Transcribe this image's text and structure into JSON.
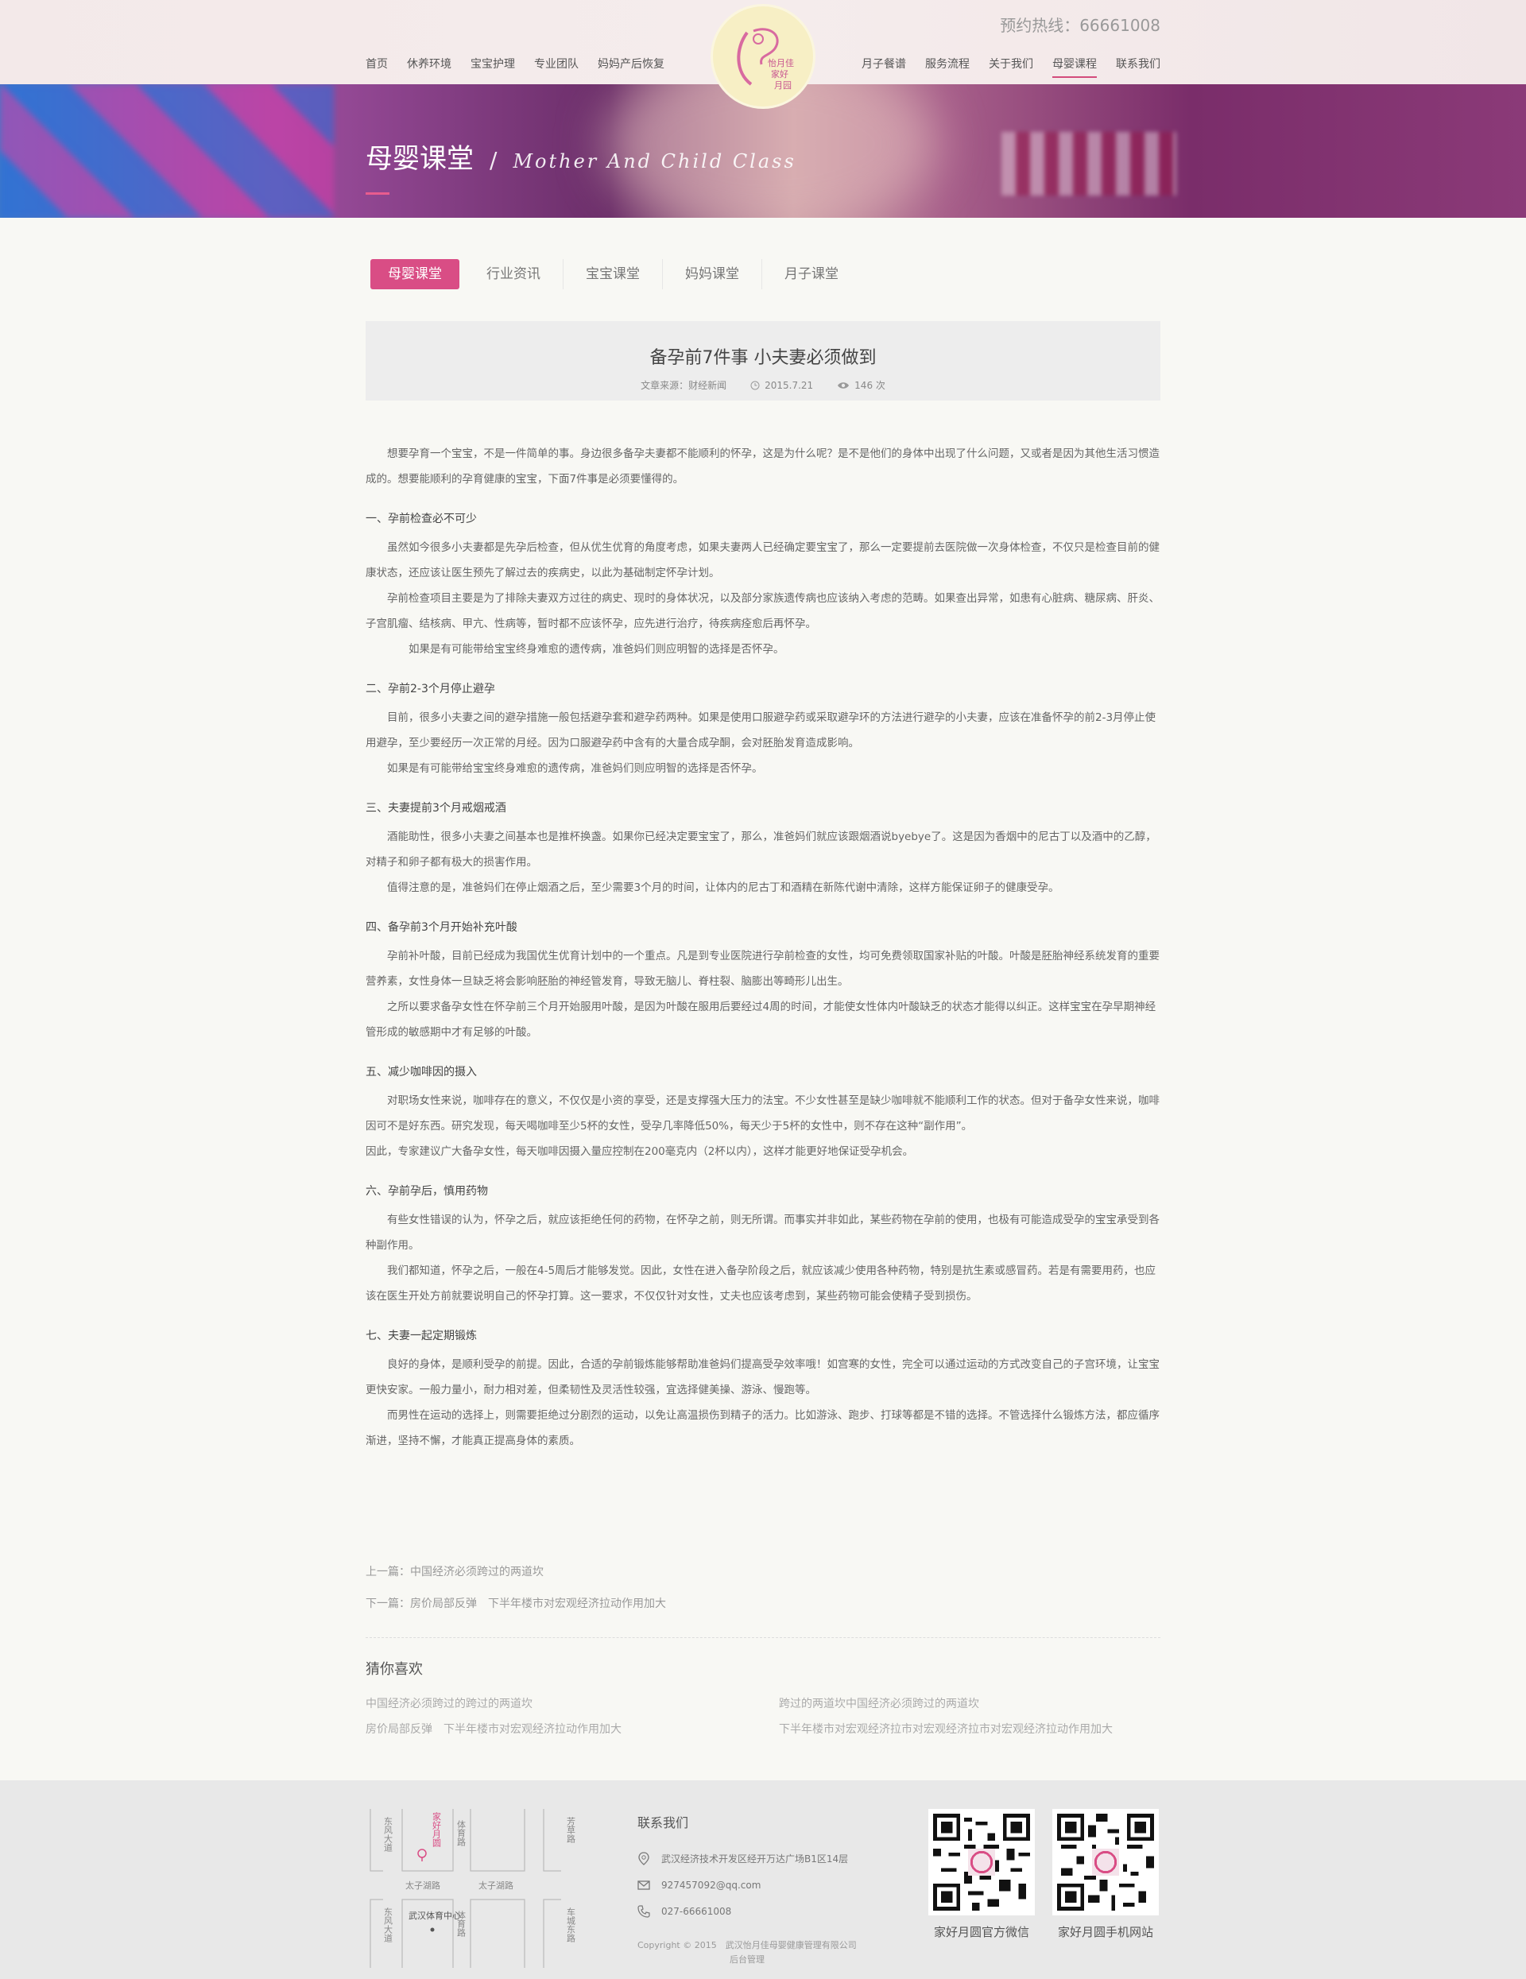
{
  "header": {
    "hotline": "预约热线：66661008",
    "nav_left": [
      "首页",
      "休养环境",
      "宝宝护理",
      "专业团队",
      "妈妈产后恢复"
    ],
    "nav_right": [
      "月子餐谱",
      "服务流程",
      "关于我们",
      "母婴课程",
      "联系我们"
    ],
    "active_nav": "母婴课程",
    "logo_text": "怡月佳家好月园"
  },
  "banner": {
    "title_cn": "母婴课堂",
    "separator": "/",
    "title_en": "Mother And Child Class"
  },
  "tabs": [
    "母婴课堂",
    "行业资讯",
    "宝宝课堂",
    "妈妈课堂",
    "月子课堂"
  ],
  "article": {
    "title": "备孕前7件事 小夫妻必须做到",
    "source": "文章来源：财经新闻",
    "date": "2015.7.21",
    "views": "146 次",
    "intro": "想要孕育一个宝宝，不是一件简单的事。身边很多备孕夫妻都不能顺利的怀孕，这是为什么呢？是不是他们的身体中出现了什么问题，又或者是因为其他生活习惯造成的。想要能顺利的孕育健康的宝宝，下面7件事是必须要懂得的。",
    "sections": [
      {
        "heading": "一、孕前检查必不可少",
        "paras": [
          "虽然如今很多小夫妻都是先孕后检查，但从优生优育的角度考虑，如果夫妻两人已经确定要宝宝了，那么一定要提前去医院做一次身体检查，不仅只是检查目前的健康状态，还应该让医生预先了解过去的疾病史，以此为基础制定怀孕计划。",
          "孕前检查项目主要是为了排除夫妻双方过往的病史、现时的身体状况，以及部分家族遗传病也应该纳入考虑的范畴。如果查出异常，如患有心脏病、糖尿病、肝炎、子宫肌瘤、结核病、甲亢、性病等，暂时都不应该怀孕，应先进行治疗，待疾病痊愈后再怀孕。",
          "如果是有可能带给宝宝终身难愈的遗传病，准爸妈们则应明智的选择是否怀孕。"
        ]
      },
      {
        "heading": "二、孕前2-3个月停止避孕",
        "paras": [
          "目前，很多小夫妻之间的避孕措施一般包括避孕套和避孕药两种。如果是使用口服避孕药或采取避孕环的方法进行避孕的小夫妻，应该在准备怀孕的前2-3月停止使用避孕，至少要经历一次正常的月经。因为口服避孕药中含有的大量合成孕酮，会对胚胎发育造成影响。",
          "如果是有可能带给宝宝终身难愈的遗传病，准爸妈们则应明智的选择是否怀孕。"
        ]
      },
      {
        "heading": "三、夫妻提前3个月戒烟戒酒",
        "paras": [
          "酒能助性，很多小夫妻之间基本也是推杯换盏。如果你已经决定要宝宝了，那么，准爸妈们就应该跟烟酒说byebye了。这是因为香烟中的尼古丁以及酒中的乙醇，对精子和卵子都有极大的损害作用。",
          "值得注意的是，准爸妈们在停止烟酒之后，至少需要3个月的时间，让体内的尼古丁和酒精在新陈代谢中清除，这样方能保证卵子的健康受孕。"
        ]
      },
      {
        "heading": "四、备孕前3个月开始补充叶酸",
        "paras": [
          "孕前补叶酸，目前已经成为我国优生优育计划中的一个重点。凡是到专业医院进行孕前检查的女性，均可免费领取国家补贴的叶酸。叶酸是胚胎神经系统发育的重要营养素，女性身体一旦缺乏将会影响胚胎的神经管发育，导致无脑儿、脊柱裂、脑膨出等畸形儿出生。",
          "之所以要求备孕女性在怀孕前三个月开始服用叶酸，是因为叶酸在服用后要经过4周的时间，才能使女性体内叶酸缺乏的状态才能得以纠正。这样宝宝在孕早期神经管形成的敏感期中才有足够的叶酸。"
        ]
      },
      {
        "heading": "五、减少咖啡因的摄入",
        "paras": [
          "对职场女性来说，咖啡存在的意义，不仅仅是小资的享受，还是支撑强大压力的法宝。不少女性甚至是缺少咖啡就不能顺利工作的状态。但对于备孕女性来说，咖啡因可不是好东西。研究发现，每天喝咖啡至少5杯的女性，受孕几率降低50%，每天少于5杯的女性中，则不存在这种“副作用”。",
          "因此，专家建议广大备孕女性，每天咖啡因摄入量应控制在200毫克内（2杯以内），这样才能更好地保证受孕机会。"
        ]
      },
      {
        "heading": "六、孕前孕后，慎用药物",
        "paras": [
          "有些女性错误的认为，怀孕之后，就应该拒绝任何的药物，在怀孕之前，则无所谓。而事实并非如此，某些药物在孕前的使用，也极有可能造成受孕的宝宝承受到各种副作用。",
          "我们都知道，怀孕之后，一般在4-5周后才能够发觉。因此，女性在进入备孕阶段之后，就应该减少使用各种药物，特别是抗生素或感冒药。若是有需要用药，也应该在医生开处方前就要说明自己的怀孕打算。这一要求，不仅仅针对女性，丈夫也应该考虑到，某些药物可能会使精子受到损伤。"
        ]
      },
      {
        "heading": "七、夫妻一起定期锻炼",
        "paras": [
          "良好的身体，是顺利受孕的前提。因此，合适的孕前锻炼能够帮助准爸妈们提高受孕效率哦！如宫寒的女性，完全可以通过运动的方式改变自己的子宫环境，让宝宝更快安家。一般力量小，耐力相对差，但柔韧性及灵活性较强，宜选择健美操、游泳、慢跑等。",
          "而男性在运动的选择上，则需要拒绝过分剧烈的运动，以免让高温损伤到精子的活力。比如游泳、跑步、打球等都是不错的选择。不管选择什么锻炼方法，都应循序渐进，坚持不懈，才能真正提高身体的素质。"
        ]
      }
    ],
    "prev_label": "上一篇：",
    "prev_title": "中国经济必须跨过的两道坎",
    "next_label": "下一篇：",
    "next_title": "房价局部反弹　下半年楼市对宏观经济拉动作用加大"
  },
  "guess": {
    "title": "猜你喜欢",
    "items": [
      "中国经济必须跨过的跨过的两道坎",
      "跨过的两道坎中国经济必须跨过的两道坎",
      "房价局部反弹　下半年楼市对宏观经济拉动作用加大",
      "下半年楼市对宏观经济拉市对宏观经济拉市对宏观经济拉动作用加大"
    ]
  },
  "footer": {
    "map_labels": {
      "road1": "东风大道",
      "poi": "家好月圆",
      "road2": "体育路",
      "road3": "芳草路",
      "road4": "太子湖路",
      "road5": "太子湖路",
      "road6": "东风大道",
      "center": "武汉体育中心",
      "road7": "体育路",
      "road8": "车城东路"
    },
    "contact_title": "联系我们",
    "address": "武汉经济技术开发区经开万达广场B1区14层",
    "email": "927457092@qq.com",
    "phone": "027-66661008",
    "copyright": "Copyright © 2015　武汉怡月佳母婴健康管理有限公司",
    "admin": "后台管理",
    "qr1_label": "家好月圆官方微信",
    "qr2_label": "家好月圆手机网站"
  },
  "colors": {
    "accent": "#d94d85",
    "footer_bg": "#e8e8e8",
    "page_bg": "#f8f8f4"
  }
}
